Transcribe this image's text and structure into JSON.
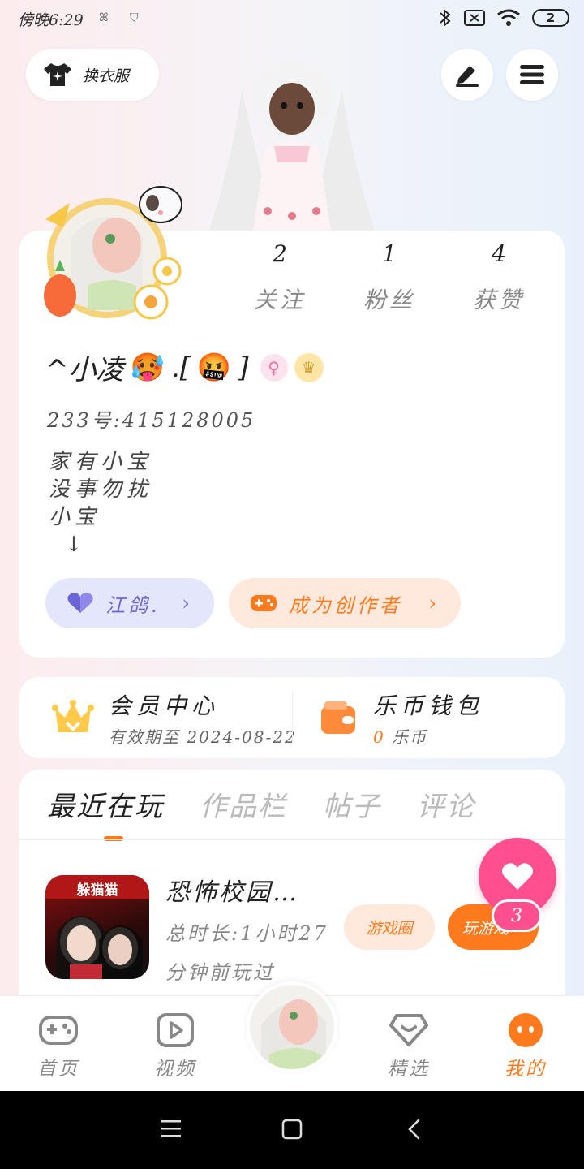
{
  "status_bar": {
    "time": "傍晚6:29",
    "mini_icons": [
      "wind-icon",
      "shield-icon"
    ],
    "battery": "2"
  },
  "header": {
    "outfit_label": "换衣服",
    "edit_icon": "edit-icon",
    "menu_icon": "menu-icon"
  },
  "profile": {
    "stats": [
      {
        "value": "2",
        "label": "关注"
      },
      {
        "value": "1",
        "label": "粉丝"
      },
      {
        "value": "4",
        "label": "获赞"
      }
    ],
    "nickname": "^小凌",
    "nickname_emoji_1": "🥵",
    "nickname_mid": ".[",
    "nickname_emoji_2": "🤬",
    "nickname_end": "]",
    "uid": "233号:415128005",
    "bio": [
      "家有小宝",
      "没事勿扰",
      "小宝",
      "↓"
    ],
    "badge_pill": "江鸽.",
    "creator_pill": "成为创作者",
    "chevron": "›"
  },
  "member": {
    "title": "会员中心",
    "subtitle": "有效期至 2024-08-22",
    "wallet_title": "乐币钱包",
    "wallet_amount": "0",
    "wallet_unit": "乐币"
  },
  "feed": {
    "tabs": [
      "最近在玩",
      "作品栏",
      "帖子",
      "评论"
    ],
    "active_tab": 0,
    "game": {
      "icon_text": "躲猫猫",
      "title": "恐怖校园…",
      "meta": "总时长:1小时27分钟前玩过",
      "circle_btn": "游戏圈",
      "play_btn": "玩游戏"
    }
  },
  "fab": {
    "count": "3"
  },
  "bottom_nav": [
    {
      "label": "首页",
      "icon": "gamepad-icon"
    },
    {
      "label": "视频",
      "icon": "play-icon"
    },
    {
      "label": "精选",
      "icon": "heart-box-icon"
    },
    {
      "label": "我的",
      "icon": "face-icon"
    }
  ],
  "colors": {
    "accent": "#ff7a1c",
    "pink": "#ff4f8e",
    "violet": "#6b66d6"
  }
}
